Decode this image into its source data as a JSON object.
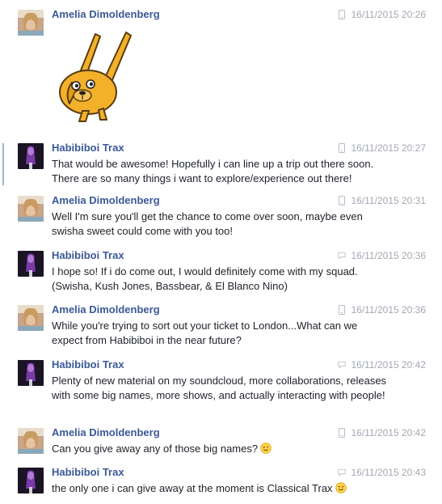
{
  "messages": [
    {
      "author": "Amelia Dimoldenberg",
      "avatar": "amelia-avatar",
      "device": "mobile-icon",
      "time": "16/11/2015 20:26",
      "text": "",
      "sticker": "jake-the-dog-sticker"
    },
    {
      "author": "Habibiboi Trax",
      "avatar": "habibiboi-avatar",
      "device": "mobile-icon",
      "time": "16/11/2015 20:27",
      "text": "That would be awesome! Hopefully i can line up a trip out there soon. There are so many things i want to explore/experience out there!"
    },
    {
      "author": "Amelia Dimoldenberg",
      "avatar": "amelia-avatar",
      "device": "mobile-icon",
      "time": "16/11/2015 20:31",
      "text": "Well I'm sure you'll get the chance to come over soon, maybe even swisha sweet could come with you too!"
    },
    {
      "author": "Habibiboi Trax",
      "avatar": "habibiboi-avatar",
      "device": "chat-icon",
      "time": "16/11/2015 20:36",
      "text": "I hope so! If i do come out, I would definitely come with my squad. (Swisha, Kush Jones, Bassbear, & El Blanco Nino)"
    },
    {
      "author": "Amelia Dimoldenberg",
      "avatar": "amelia-avatar",
      "device": "mobile-icon",
      "time": "16/11/2015 20:36",
      "text": "While you're trying to sort out your ticket to London...What can we expect from Habibiboi in the near future?"
    },
    {
      "author": "Habibiboi Trax",
      "avatar": "habibiboi-avatar",
      "device": "chat-icon",
      "time": "16/11/2015 20:42",
      "text": "Plenty of new material on my soundcloud, more collaborations, releases with some big names, more shows, and actually interacting with people!"
    },
    {
      "author": "Amelia Dimoldenberg",
      "avatar": "amelia-avatar",
      "device": "mobile-icon",
      "time": "16/11/2015 20:42",
      "text": "Can you give away any of those big names?",
      "emoji": "wink-emoji-icon"
    },
    {
      "author": "Habibiboi Trax",
      "avatar": "habibiboi-avatar",
      "device": "chat-icon",
      "time": "16/11/2015 20:43",
      "text": "the only one i can give away at the moment is Classical Trax",
      "emoji": "smile-emoji-icon"
    }
  ],
  "colors": {
    "name": "#3b5998",
    "meta": "#a3a8b3",
    "text": "#1d2129",
    "accent": "#9fb2cf"
  }
}
